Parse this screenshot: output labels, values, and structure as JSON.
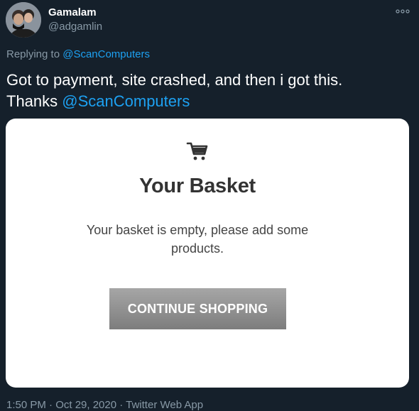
{
  "tweet": {
    "author": {
      "display_name": "Gamalam",
      "handle": "@adgamlin"
    },
    "replying_to_label": "Replying to ",
    "replying_to_handle": "@ScanComputers",
    "text_line1": "Got to payment, site crashed, and then i got this.",
    "text_line2_prefix": "Thanks ",
    "text_line2_mention": "@ScanComputers",
    "timestamp": "1:50 PM · Oct 29, 2020 · Twitter Web App"
  },
  "screenshot": {
    "title": "Your Basket",
    "message": "Your basket is empty, please add some products.",
    "button_label": "CONTINUE SHOPPING",
    "icon": "shopping-cart-icon"
  },
  "icons": {
    "more": "more-options-icon",
    "avatar": "avatar"
  },
  "colors": {
    "background": "#15202b",
    "link": "#1da1f2",
    "muted": "#8899a6",
    "button": "#8f8f8f"
  }
}
